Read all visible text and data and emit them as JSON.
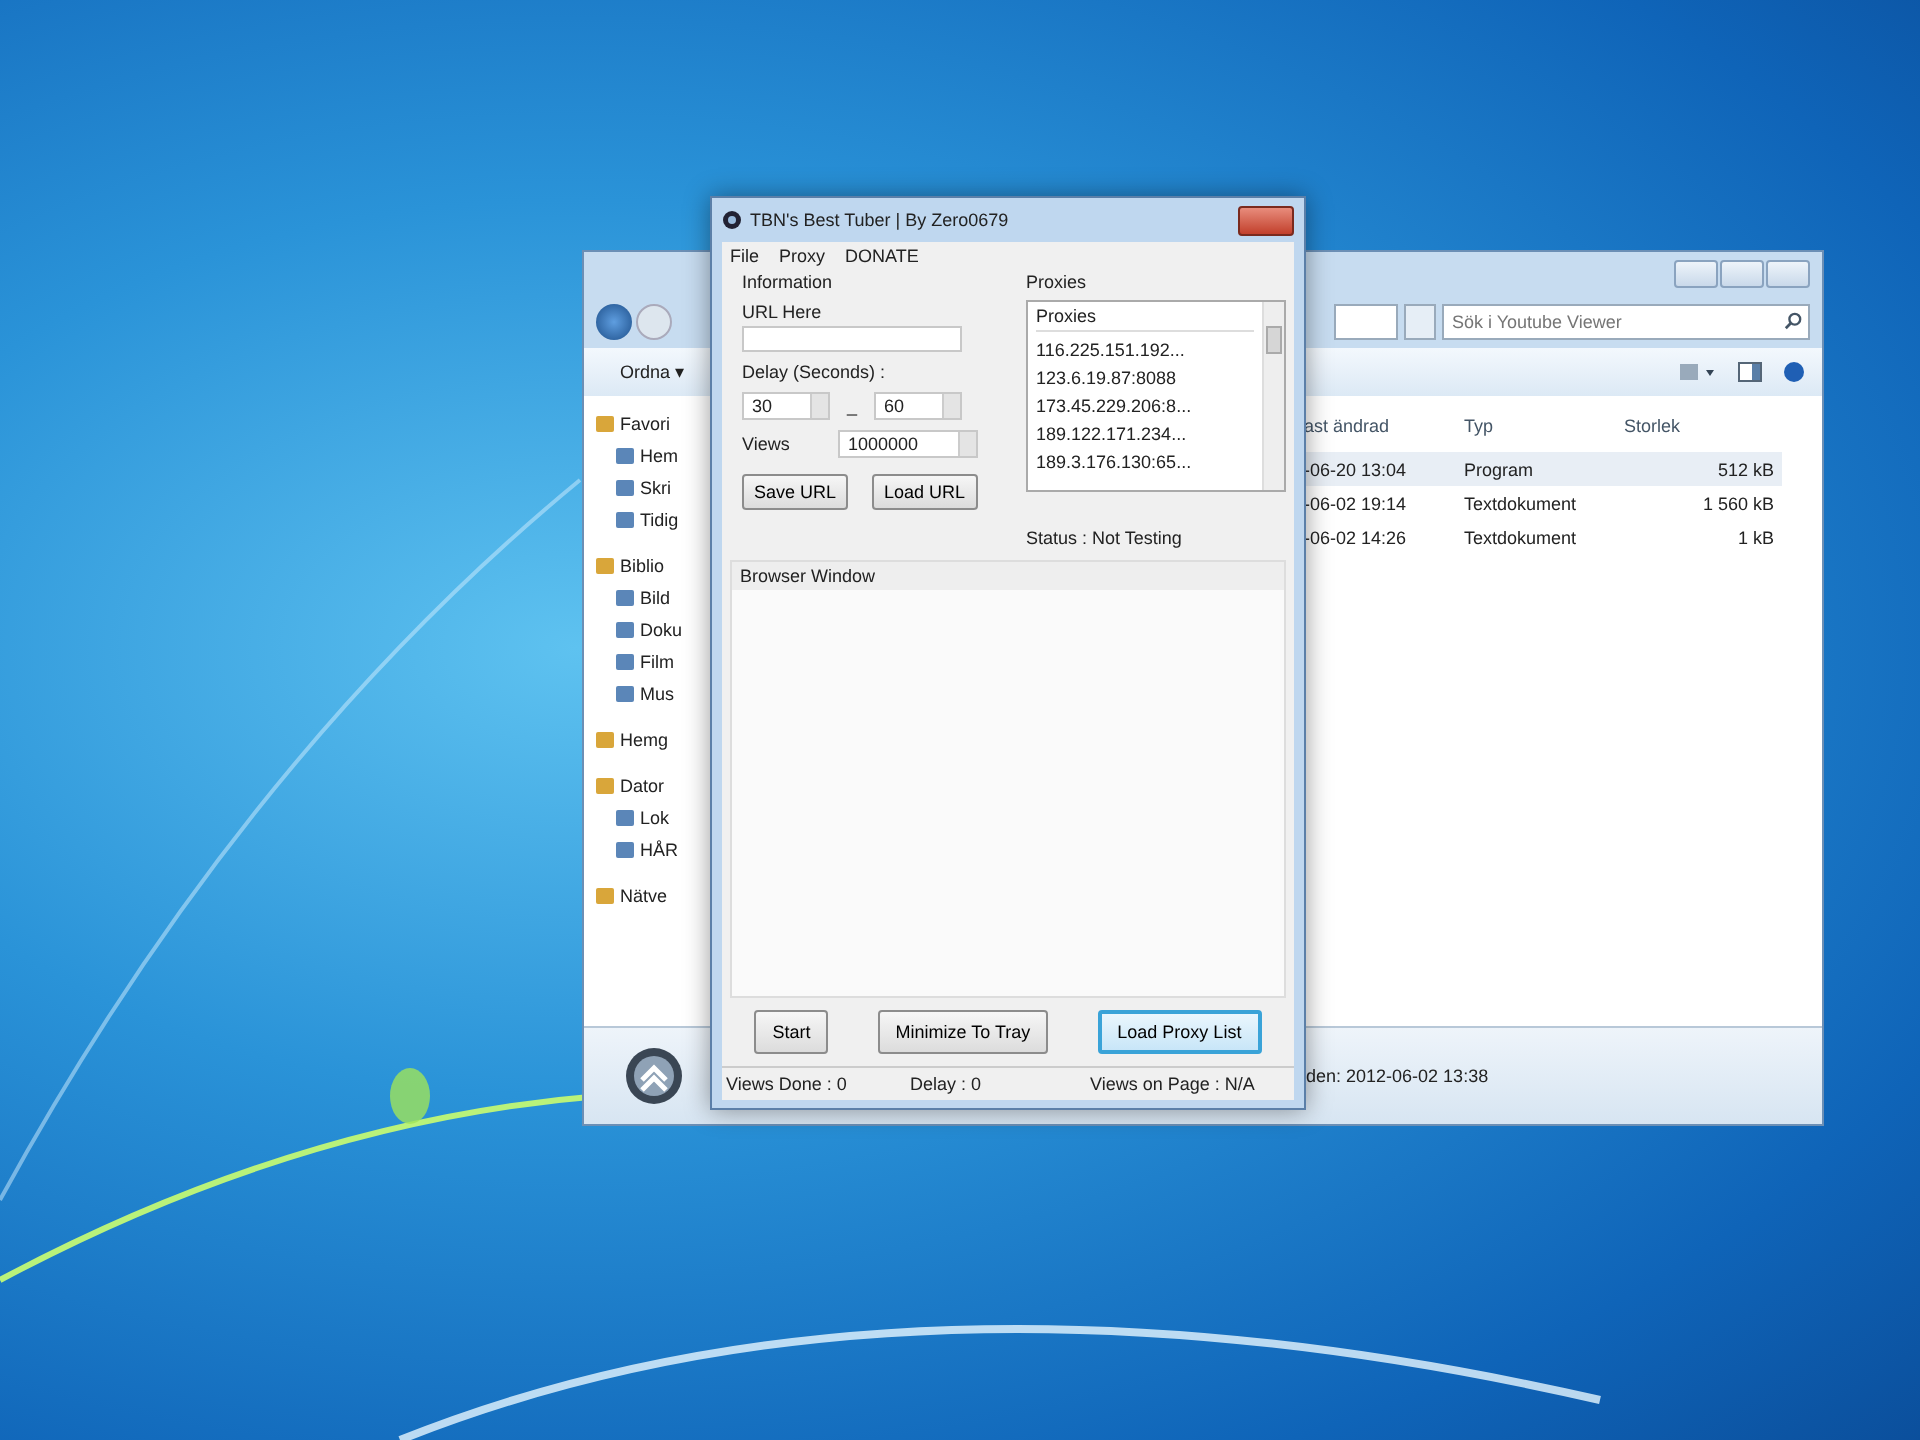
{
  "explorer": {
    "organize": "Ordna ▾",
    "search": {
      "placeholder": "Sök i Youtube Viewer"
    },
    "nav_items": [
      {
        "label": "Favori",
        "kind": "group"
      },
      {
        "label": "Hem",
        "kind": "item"
      },
      {
        "label": "Skri",
        "kind": "item"
      },
      {
        "label": "Tidig",
        "kind": "item"
      },
      {
        "label": "Biblio",
        "kind": "group"
      },
      {
        "label": "Bild",
        "kind": "item"
      },
      {
        "label": "Doku",
        "kind": "item"
      },
      {
        "label": "Film",
        "kind": "item"
      },
      {
        "label": "Mus",
        "kind": "item"
      },
      {
        "label": "Hemg",
        "kind": "group"
      },
      {
        "label": "Dator",
        "kind": "group"
      },
      {
        "label": "Lok",
        "kind": "item"
      },
      {
        "label": "HÅR",
        "kind": "item"
      },
      {
        "label": "Nätve",
        "kind": "group"
      }
    ],
    "columns": [
      "ast ändrad",
      "Typ",
      "Storlek"
    ],
    "rows": [
      {
        "date": "-06-20 13:04",
        "type": "Program",
        "size": "512 kB",
        "selected": true
      },
      {
        "date": "-06-02 19:14",
        "type": "Textdokument",
        "size": "1 560 kB",
        "selected": false
      },
      {
        "date": "-06-02 14:26",
        "type": "Textdokument",
        "size": "1 kB",
        "selected": false
      }
    ],
    "details": "den: 2012-06-02 13:38"
  },
  "app": {
    "title": "TBN's Best Tuber | By Zero0679",
    "menu": [
      "File",
      "Proxy",
      "DONATE"
    ],
    "information": {
      "title": "Information",
      "url_label": "URL Here",
      "delay_label": "Delay (Seconds) :",
      "delay_min": "30",
      "delay_sep": "_",
      "delay_max": "60",
      "views_label": "Views",
      "views_value": "1000000"
    },
    "info_buttons": [
      {
        "label": "Save URL",
        "focused": false
      },
      {
        "label": "Load URL",
        "focused": false
      }
    ],
    "proxies": {
      "title": "Proxies",
      "header": "Proxies",
      "items": [
        "116.225.151.192...",
        "123.6.19.87:8088",
        "173.45.229.206:8...",
        "189.122.171.234...",
        "189.3.176.130:65..."
      ]
    },
    "status": "Status : Not Testing",
    "browser_title": "Browser Window",
    "buttons": [
      {
        "label": "Start",
        "focused": false
      },
      {
        "label": "Minimize To Tray",
        "focused": false
      },
      {
        "label": "Load Proxy List",
        "focused": true
      }
    ],
    "status_bar": [
      "Views Done : 0",
      "Delay : 0",
      "Views on Page : N/A"
    ]
  }
}
